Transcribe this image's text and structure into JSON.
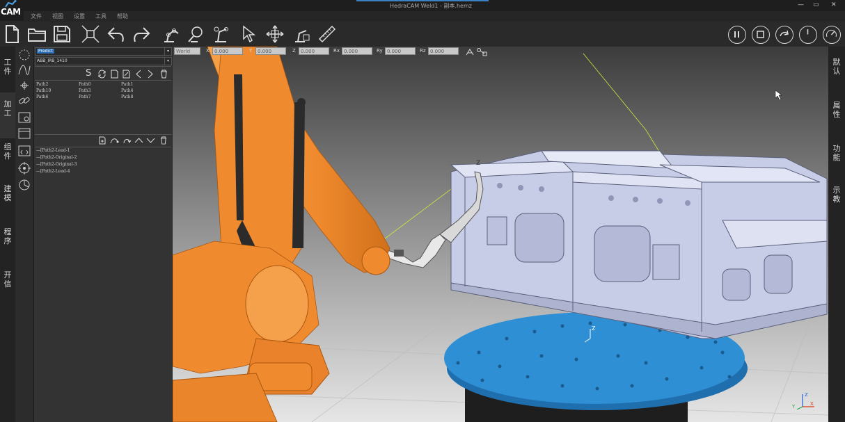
{
  "app": {
    "logo_text": "CAM",
    "window_title": "HedraCAM  Weld1 - 副本.hemz"
  },
  "menu": {
    "items": [
      "文件",
      "视图",
      "设置",
      "工具",
      "帮助"
    ]
  },
  "window_controls": {
    "minimize": "—",
    "restore": "▭",
    "close": "✕"
  },
  "left_rail": {
    "tabs": [
      "工件",
      "加工",
      "组件",
      "建模",
      "程序",
      "开信"
    ]
  },
  "right_rail": {
    "tabs": [
      "默认",
      "属性",
      "功能",
      "示教"
    ]
  },
  "panel": {
    "selector1": "Predict",
    "selector2": "ABB_IRB_1410",
    "path_list": [
      "Path2",
      "Path0",
      "Path1",
      "Path10",
      "Path3",
      "Path4",
      "Path6",
      "Path7",
      "Path8"
    ],
    "tree_items": [
      "Path2-Lead-1",
      "Path2-Original-2",
      "Path2-Original-3",
      "Path2-Lead-4"
    ]
  },
  "coords": {
    "frame": "World",
    "fields": [
      {
        "label": "X",
        "value": "0.000"
      },
      {
        "label": "Y",
        "value": "0.000"
      },
      {
        "label": "Z",
        "value": "0.000"
      },
      {
        "label": "Rx",
        "value": "0.000"
      },
      {
        "label": "Ry",
        "value": "0.000"
      },
      {
        "label": "Rz",
        "value": "0.000"
      }
    ]
  },
  "scene": {
    "axis_label": "Z",
    "triad_labels": {
      "z": "Z",
      "x": "X",
      "y": "Y"
    },
    "colors": {
      "robot": "#f08a2e",
      "robot_dark": "#d0701a",
      "table": "#2e8fd4",
      "fixture": "#c7cde6",
      "weld_line": "#d4e63a",
      "background_top": "#3c3c3c",
      "background_bottom": "#e6e6e6"
    }
  }
}
